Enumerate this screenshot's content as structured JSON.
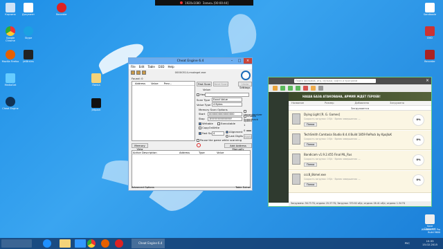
{
  "recording_bar": {
    "resolution": "1920x1080",
    "status": "Запись [00:00:44]"
  },
  "desktop_left": [
    {
      "label": "Корзина"
    },
    {
      "label": "Документ"
    },
    {
      "label": "Recorder"
    },
    {
      "label": "Google Chrome"
    },
    {
      "label": "Skype"
    },
    {
      "label": "Mozilla Firefox"
    },
    {
      "label": "JetBrains"
    },
    {
      "label": "MediaGet"
    },
    {
      "label": "Cheat Engine"
    },
    {
      "label": "Папка"
    }
  ],
  "desktop_right": [
    {
      "label": "Sandboxie"
    },
    {
      "label": "DVD"
    },
    {
      "label": "Recorder"
    },
    {
      "label": "Tools"
    }
  ],
  "desktop_misc": [
    {
      "label": "Jetpack"
    },
    {
      "label": "Save Clipboard"
    }
  ],
  "cheat_engine": {
    "title": "Cheat Engine 6.4",
    "menu": [
      "File",
      "Edit",
      "Table",
      "D3D",
      "Help"
    ],
    "process": "00000514-msdegel.exe",
    "found": "Found: 0",
    "list_columns": [
      "Address",
      "Value",
      "Prev..."
    ],
    "first_scan": "First Scan",
    "next_scan": "Next Scan",
    "undo_scan": "Undo Scan",
    "settings": "Settings",
    "value_label": "Value:",
    "hex": "Hex",
    "scan_type_label": "Scan Type",
    "scan_type": "Exact Value",
    "value_type_label": "Value Type",
    "value_type": "4 Bytes",
    "memory_scan_options": "Memory Scan Options",
    "start_label": "Start",
    "start_value": "0000000000000000",
    "stop_label": "Stop",
    "stop_value": "7FFFFFFFFFFFFFFF",
    "writable": "Writable",
    "executable": "Executable",
    "copy_on_write": "CopyOnWrite",
    "fast_scan": "Fast Scan",
    "fast_scan_value": "4",
    "alignment": "Alignment",
    "last_digits": "Last Digits",
    "pause": "Pause the game while scanning",
    "unrandomizer": "Unrandomizer",
    "enable_speedhack": "Enable Speedhack",
    "speed_label": "Speed",
    "speed_value": "1",
    "speed_min": "0",
    "speed_max": "20",
    "apply": "Apply",
    "memory_view": "Memory View",
    "add_address": "Add Address Manually",
    "addr_columns": [
      "Active",
      "Description",
      "Address",
      "Type",
      "Value"
    ],
    "advanced_options": "Advanced Options",
    "table_extras": "Table Extras"
  },
  "mediaget": {
    "search_placeholder": "Поиск фильмов, игр, музыки, софта и программ",
    "banner": "НАША БАЗА АТАКОВАНА, АРМИЯ ЖДЕТ ГЕРОЕВ!",
    "columns": [
      "Название",
      "Размер",
      "Добавлено",
      "Загружено"
    ],
    "section": "Загружается",
    "downloads": [
      {
        "name": "Dying Light [R. G. Games]",
        "sub": "Скорость загрузки: 0 б/с · Время завершения: —",
        "folder": "Папка",
        "percent": "0%"
      },
      {
        "name": "TechSmith Camtasia Studio 8.4.4 Build 1859 RePack by KpoJIuK",
        "sub": "Скорость загрузки: 0 б/с · Время завершения: —",
        "folder": "Папка",
        "percent": "0%"
      },
      {
        "name": "Bandicam v1.9.2.455 Final ML_Rus",
        "sub": "Скорость загрузки: 0 б/с · Время завершения: —",
        "folder": "Папка",
        "percent": "0%"
      },
      {
        "name": "ccc8_8kmel.exe",
        "sub": "Скорость загрузки: 0 б/с · Время завершения: —",
        "folder": "Папка",
        "percent": "0%"
      }
    ],
    "footer": "Загружено: 36.73 ГБ; отдано: 25.37 ГБ; Загрузка: 370.92 кБ/с; отдача: 26.41 кБ/с; отдано: 1.34 ГБ"
  },
  "taskbar": {
    "active_label": "Cheat Engine 6.4",
    "lang": "РУС",
    "time": "15:33",
    "date": "15.02.2015"
  },
  "watermark": {
    "line1": "Windows 8.1 Pro",
    "line2": "Build 9600"
  }
}
